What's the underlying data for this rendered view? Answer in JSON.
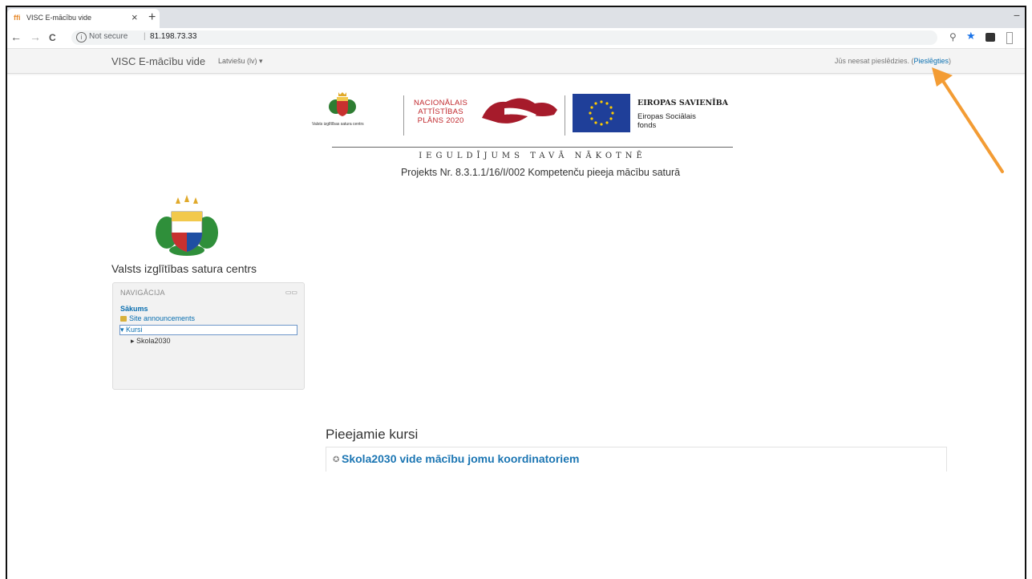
{
  "browser": {
    "tab_title": "VISC E-mācību vide",
    "tab_favicon": "moodle-favicon",
    "close_glyph": "×",
    "new_tab_glyph": "+",
    "minimize_glyph": "−",
    "not_secure": "Not secure",
    "separator": "|",
    "url": "81.198.73.33",
    "back_glyph": "←",
    "forward_glyph": "→",
    "reload_glyph": "C",
    "info_glyph": "i",
    "zoom_glyph": "⚲",
    "star_glyph": "★"
  },
  "navbar": {
    "brand": "VISC E-mācību vide",
    "language": "Latviešu (lv) ▾",
    "login_prefix": "Jūs neesat pieslēdzies. (",
    "login_link": "Pieslēgties",
    "login_suffix": ")"
  },
  "banner": {
    "org_small": "Valsts izglītības satura centrs",
    "nap_line1": "NACIONĀLAIS",
    "nap_line2": "ATTĪSTĪBAS",
    "nap_line3": "PLĀNS 2020",
    "eu_title": "EIROPAS SAVIENĪBA",
    "eu_sub1": "Eiropas Sociālais",
    "eu_sub2": "fonds",
    "motto": "IEGULDĪJUMS TAVĀ NĀKOTNĒ",
    "project": "Projekts Nr. 8.3.1.1/16/I/002 Kompetenču pieeja mācību saturā",
    "eu_color": "#1f3f99",
    "nap_color": "#c0282d"
  },
  "sidebar": {
    "org_name": "Valsts izglītības satura centrs",
    "nav_title": "NAVIGĀCIJA",
    "nav_controls": "▭▭",
    "home": "Sākums",
    "announcements": "Site announcements",
    "kursi": "▾ Kursi",
    "skola": "▸ Skola2030"
  },
  "main": {
    "section_title": "Pieejamie kursi",
    "course_title": "Skola2030 vide mācību jomu koordinatoriem",
    "course_icon": "course-icon"
  },
  "annotation": {
    "arrow_color": "#f39c34"
  }
}
